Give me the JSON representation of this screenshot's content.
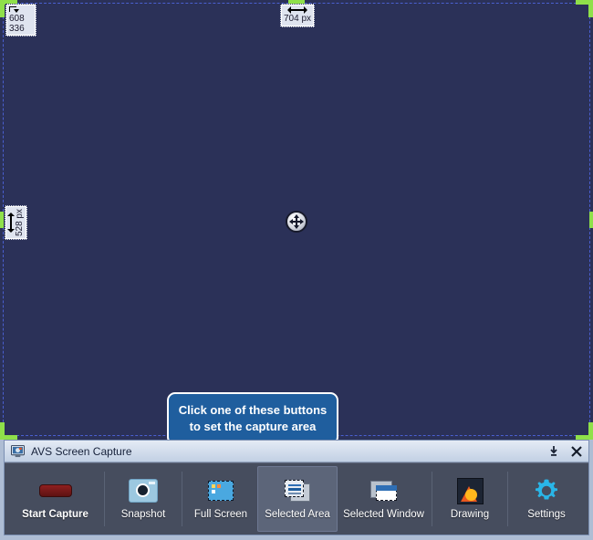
{
  "overlay": {
    "position_badge": {
      "icon": "move-position-icon",
      "x_value": "608",
      "y_value": "336"
    },
    "width_badge": {
      "icon": "horizontal-resize-icon",
      "label": "704 px"
    },
    "height_badge": {
      "icon": "vertical-resize-icon",
      "label": "528 px"
    },
    "move_knob": {
      "icon": "move-crosshair-icon"
    },
    "selection_border_color": "#4a5fd0",
    "handle_color": "#8fe04a",
    "backdrop_color": "#2b3158"
  },
  "callout": {
    "line1": "Click one of these buttons",
    "line2": "to set the capture area",
    "background_color": "#1f5e9e",
    "border_color": "#ffffff"
  },
  "window": {
    "title": "AVS Screen Capture",
    "app_icon": "monitor-capture-icon",
    "controls": [
      {
        "name": "minimize-button",
        "icon": "minimize-icon",
        "glyph": "minimize"
      },
      {
        "name": "close-button",
        "icon": "close-icon",
        "glyph": "close"
      }
    ],
    "titlebar_color": "#c2d0e4",
    "toolbar_color": "#464d5e"
  },
  "toolbar": {
    "buttons": [
      {
        "name": "start-capture-button",
        "label": "Start Capture",
        "icon": "record-button-icon",
        "active": false,
        "bold": true
      },
      {
        "name": "snapshot-button",
        "label": "Snapshot",
        "icon": "camera-icon",
        "active": false,
        "bold": false
      },
      {
        "name": "full-screen-button",
        "label": "Full Screen",
        "icon": "full-screen-icon",
        "active": false,
        "bold": false
      },
      {
        "name": "selected-area-button",
        "label": "Selected Area",
        "icon": "selected-area-icon",
        "active": true,
        "bold": false
      },
      {
        "name": "selected-window-button",
        "label": "Selected Window",
        "icon": "selected-window-icon",
        "active": false,
        "bold": false
      },
      {
        "name": "drawing-button",
        "label": "Drawing",
        "icon": "drawing-icon",
        "active": false,
        "bold": false
      },
      {
        "name": "settings-button",
        "label": "Settings",
        "icon": "gear-icon",
        "active": false,
        "bold": false
      }
    ],
    "accent_color": "#29b6e8",
    "active_button_color": "#5c6579"
  }
}
